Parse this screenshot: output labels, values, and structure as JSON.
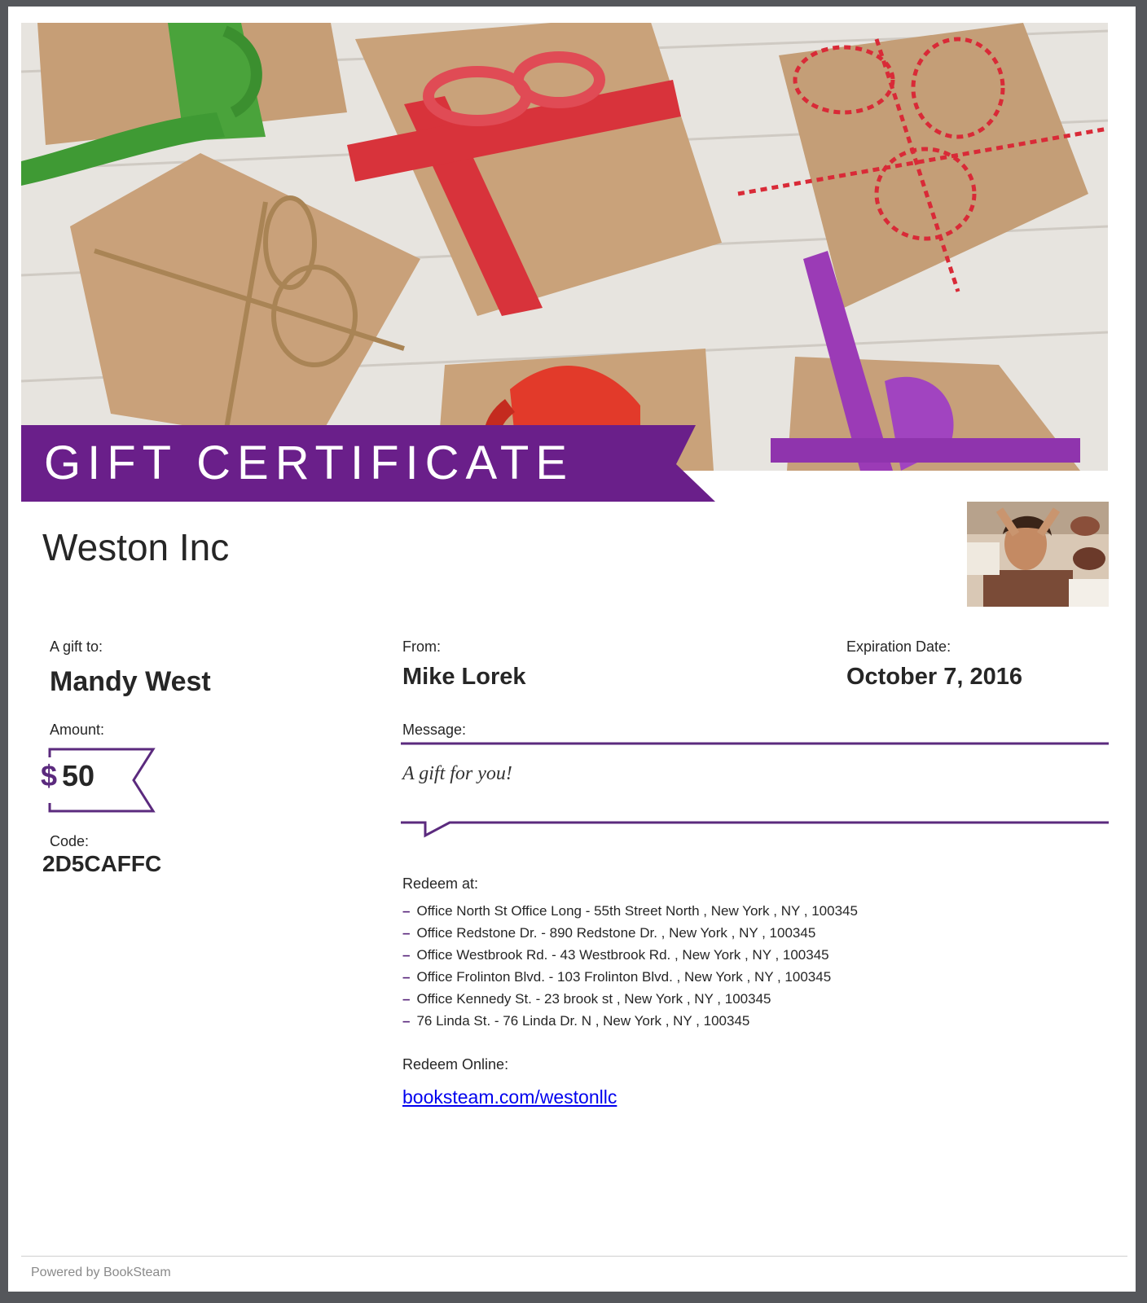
{
  "certificate": {
    "title": "GIFT CERTIFICATE",
    "business_name": "Weston Inc"
  },
  "recipient": {
    "label": "A gift to:",
    "name": "Mandy West"
  },
  "sender": {
    "label": "From:",
    "name": "Mike Lorek"
  },
  "expiration": {
    "label": "Expiration Date:",
    "date": "October 7, 2016"
  },
  "amount": {
    "label": "Amount:",
    "currency": "$",
    "value": "50"
  },
  "code": {
    "label": "Code:",
    "value": "2D5CAFFC"
  },
  "message": {
    "label": "Message:",
    "text": "A gift for you!"
  },
  "redeem": {
    "label": "Redeem at:",
    "locations": [
      "Office North St Office Long - 55th Street North , New York , NY , 100345",
      "Office Redstone Dr. - 890 Redstone Dr. ,  New York , NY , 100345",
      "Office Westbrook Rd. - 43 Westbrook Rd. ,  New York , NY , 100345",
      "Office Frolinton Blvd. - 103 Frolinton Blvd. ,  New York , NY , 100345",
      "Office Kennedy St. - 23 brook st ,  New York , NY , 100345",
      "76 Linda St. - 76 Linda Dr. N ,  New York , NY , 100345"
    ],
    "online_label": "Redeem Online:",
    "online_link": "booksteam.com/westonllc"
  },
  "footer": {
    "text": "Powered by BookSteam"
  },
  "colors": {
    "brand_purple": "#6a1f8a",
    "paper": "#c8a27a",
    "wood": "#e6e3de"
  },
  "icons": {
    "hero_image": "gift-boxes-photo",
    "thumbnail": "spa-massage-photo"
  }
}
